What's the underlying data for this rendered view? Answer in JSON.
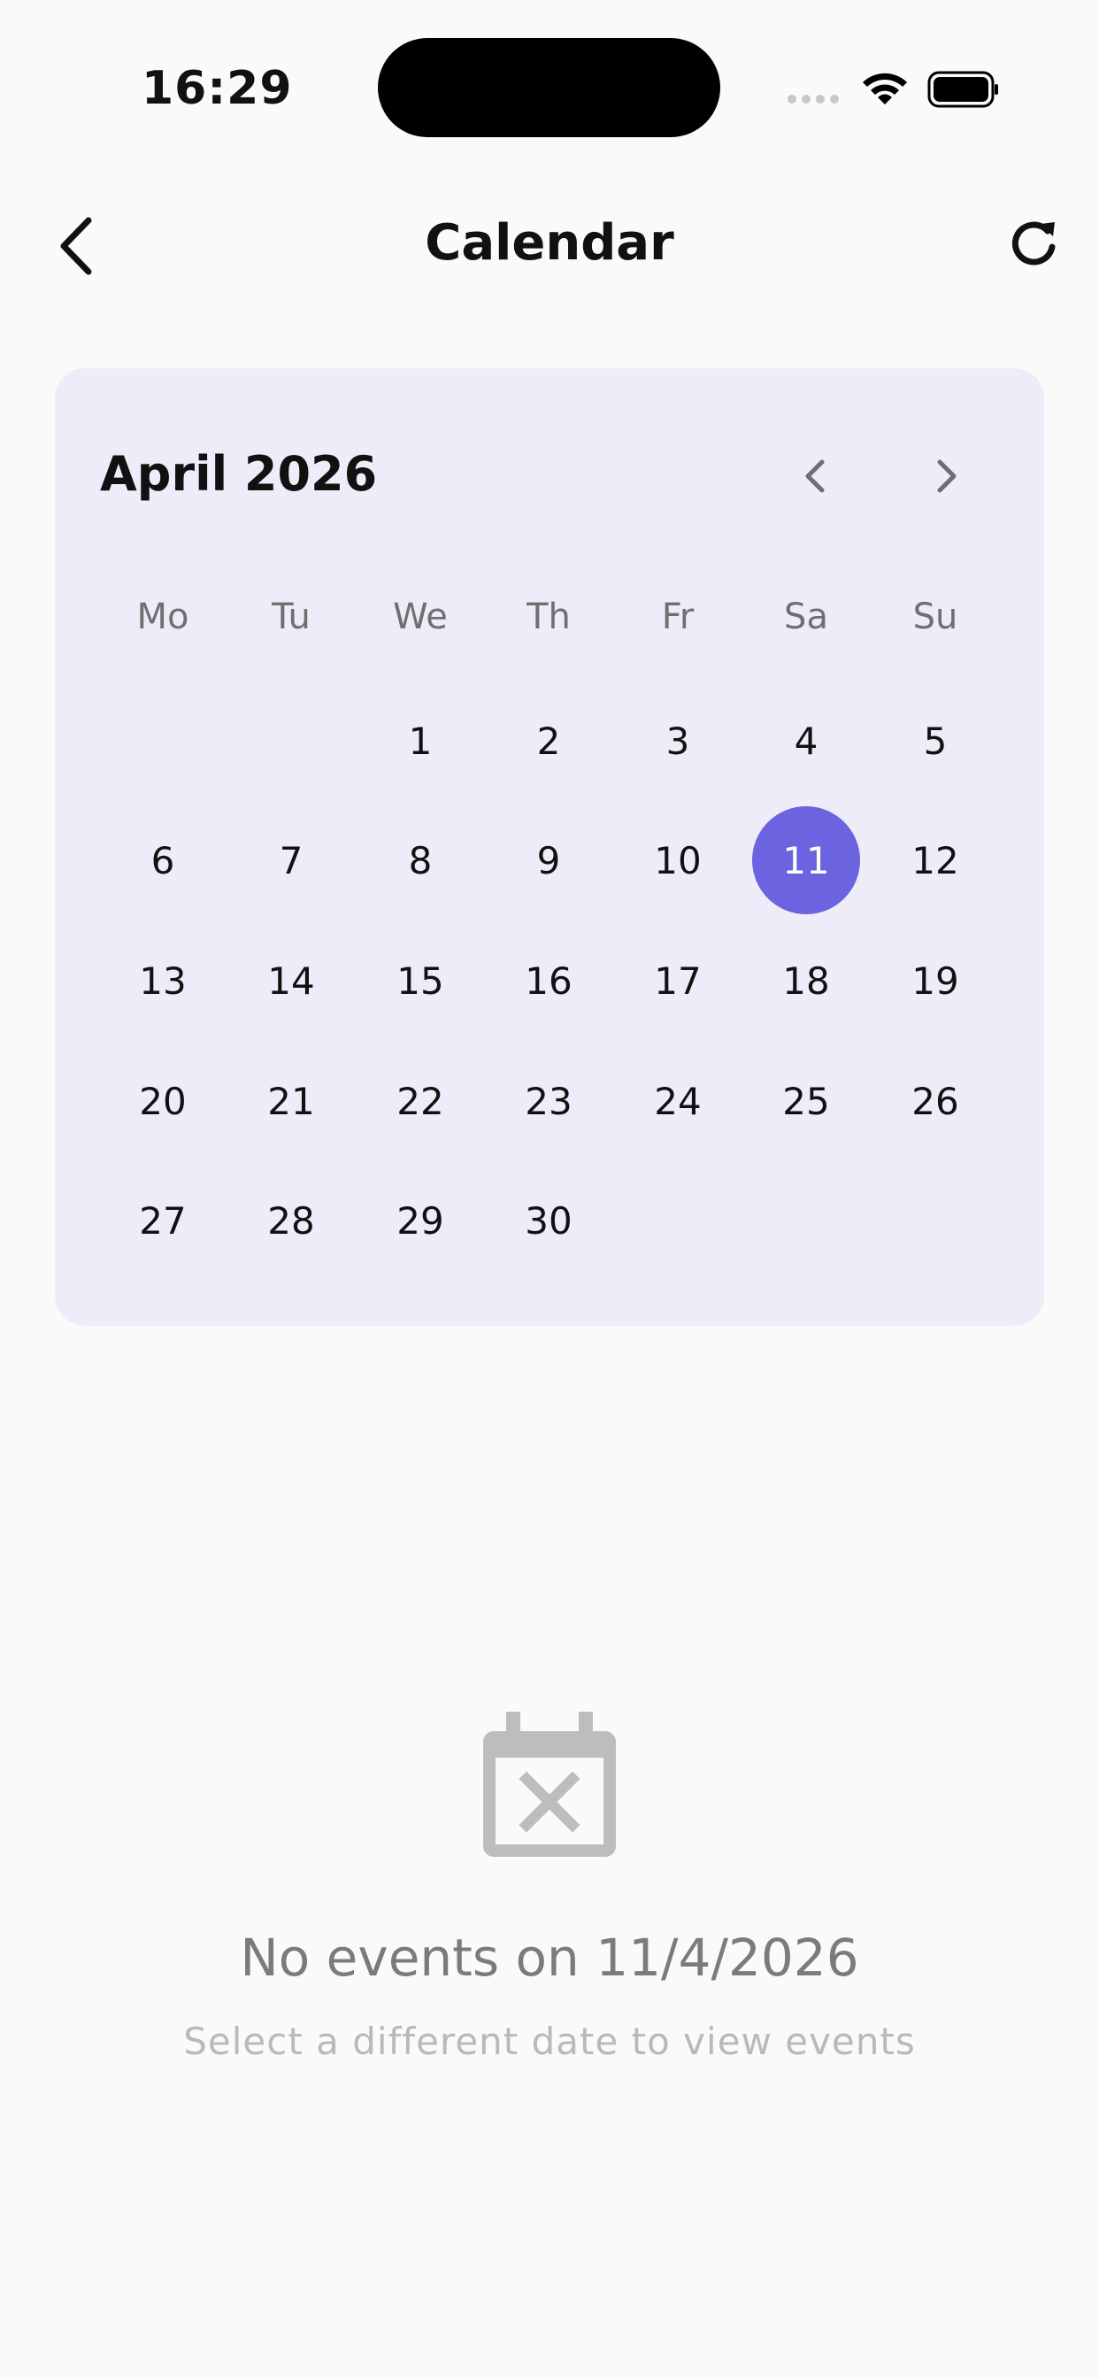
{
  "status_bar": {
    "time": "16:29"
  },
  "header": {
    "title": "Calendar"
  },
  "calendar": {
    "month_label": "April 2026",
    "weekdays": [
      "Mo",
      "Tu",
      "We",
      "Th",
      "Fr",
      "Sa",
      "Su"
    ],
    "selected_day": "11",
    "accent_color": "#6c63e0",
    "weeks": [
      [
        "",
        "",
        "1",
        "2",
        "3",
        "4",
        "5"
      ],
      [
        "6",
        "7",
        "8",
        "9",
        "10",
        "11",
        "12"
      ],
      [
        "13",
        "14",
        "15",
        "16",
        "17",
        "18",
        "19"
      ],
      [
        "20",
        "21",
        "22",
        "23",
        "24",
        "25",
        "26"
      ],
      [
        "27",
        "28",
        "29",
        "30",
        "",
        "",
        ""
      ]
    ]
  },
  "empty_state": {
    "icon": "calendar-x-icon",
    "title": "No events on 11/4/2026",
    "subtitle": "Select a different date to view events"
  }
}
